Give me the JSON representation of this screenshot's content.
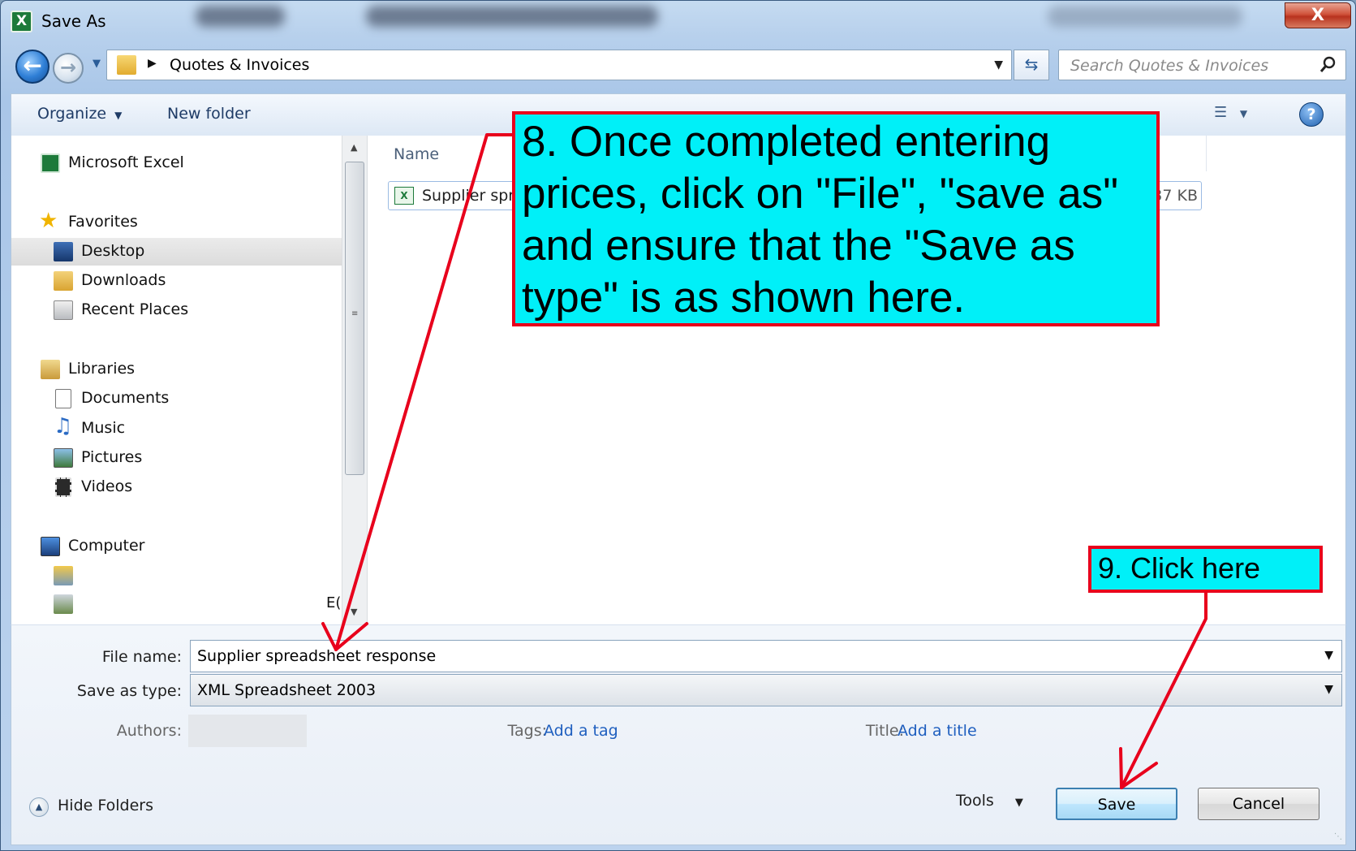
{
  "window": {
    "title": "Save As",
    "close_label": "X"
  },
  "address": {
    "path": "Quotes & Invoices",
    "search_placeholder": "Search Quotes & Invoices"
  },
  "toolbar": {
    "organize_label": "Organize",
    "new_folder_label": "New folder",
    "help_label": "?"
  },
  "nav": {
    "items": [
      {
        "label": "Microsoft Excel",
        "icon": "excel-icon"
      },
      {
        "label": "Favorites",
        "icon": "star-icon"
      },
      {
        "label": "Desktop",
        "icon": "desktop-icon",
        "selected": true
      },
      {
        "label": "Downloads",
        "icon": "downloads-folder-icon"
      },
      {
        "label": "Recent Places",
        "icon": "recent-places-icon"
      },
      {
        "label": "Libraries",
        "icon": "libraries-icon"
      },
      {
        "label": "Documents",
        "icon": "documents-icon"
      },
      {
        "label": "Music",
        "icon": "music-icon"
      },
      {
        "label": "Pictures",
        "icon": "pictures-icon"
      },
      {
        "label": "Videos",
        "icon": "videos-icon"
      },
      {
        "label": "Computer",
        "icon": "computer-icon"
      },
      {
        "label": "",
        "icon": "local-disk-icon"
      },
      {
        "label": "",
        "icon": "network-drive-icon"
      }
    ],
    "clipped_drive_label": "E("
  },
  "files": {
    "column_name": "Name",
    "rows": [
      {
        "name": "Supplier spre",
        "size": "37 KB"
      }
    ]
  },
  "form": {
    "file_name_label": "File name:",
    "file_name_value": "Supplier spreadsheet response",
    "save_as_type_label": "Save as type:",
    "save_as_type_value": "XML Spreadsheet 2003",
    "authors_label": "Authors:",
    "tags_label": "Tags:",
    "tags_link": "Add a tag",
    "title_label": "Title:",
    "title_link": "Add a title",
    "hide_folders_label": "Hide Folders",
    "tools_label": "Tools",
    "save_label": "Save",
    "cancel_label": "Cancel"
  },
  "annotations": {
    "step8": "8. Once completed entering prices, click on \"File\", \"save as\" and ensure that the \"Save as type\" is as shown here.",
    "step9": "9. Click here",
    "color": "#e8001c",
    "fill": "#00f0f8"
  }
}
